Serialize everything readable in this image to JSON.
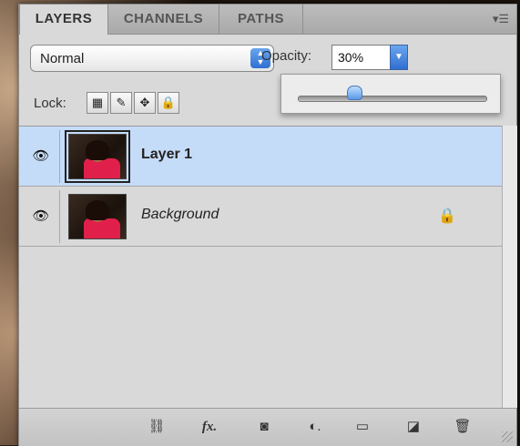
{
  "tabs": [
    {
      "label": "LAYERS",
      "active": true
    },
    {
      "label": "CHANNELS",
      "active": false
    },
    {
      "label": "PATHS",
      "active": false
    }
  ],
  "blend_mode": {
    "value": "Normal"
  },
  "opacity": {
    "label": "Opacity:",
    "value": "30%",
    "fraction": 0.3
  },
  "lock": {
    "label": "Lock:",
    "icons": [
      "transparency-lock-icon",
      "brush-lock-icon",
      "move-lock-icon",
      "padlock-icon"
    ]
  },
  "layers": [
    {
      "name": "Layer 1",
      "visible": true,
      "selected": true,
      "locked": false
    },
    {
      "name": "Background",
      "visible": true,
      "selected": false,
      "locked": true
    }
  ],
  "toolbar_icons": [
    "link-icon",
    "fx-icon",
    "mask-icon",
    "adjustment-icon",
    "folder-icon",
    "new-layer-icon",
    "trash-icon"
  ],
  "colors": {
    "selection": "#c5dcf8",
    "accent": "#2f6fd1"
  }
}
